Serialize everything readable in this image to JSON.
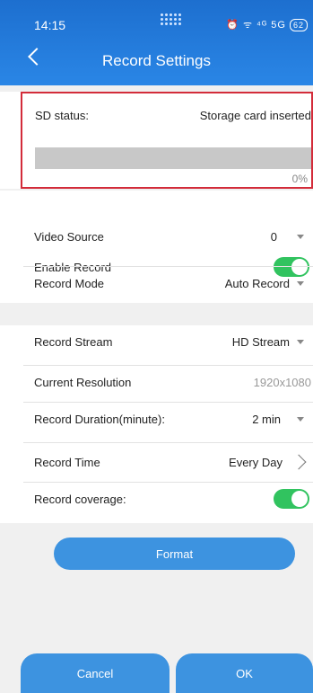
{
  "status_bar": {
    "time": "14:15",
    "signal_text": "⁴ᴳ 5G",
    "battery": "62"
  },
  "header": {
    "title": "Record Settings"
  },
  "sd": {
    "label": "SD status:",
    "value": "Storage card inserted",
    "progress_percent": 0,
    "progress_text": "0%"
  },
  "rows": {
    "video_source": {
      "label": "Video Source",
      "value": "0"
    },
    "enable_record": {
      "label": "Enable Record",
      "on": true
    },
    "record_mode": {
      "label": "Record Mode",
      "value": "Auto Record"
    },
    "record_stream": {
      "label": "Record Stream",
      "value": "HD Stream"
    },
    "current_resolution": {
      "label": "Current Resolution",
      "value": "1920x1080"
    },
    "record_duration": {
      "label": "Record Duration(minute):",
      "value": "2 min"
    },
    "record_time": {
      "label": "Record Time",
      "value": "Every Day"
    },
    "record_coverage": {
      "label": "Record coverage:",
      "on": true
    }
  },
  "buttons": {
    "format": "Format",
    "cancel": "Cancel",
    "ok": "OK"
  },
  "colors": {
    "header": "#2a86e6",
    "toggle_on": "#31c35f",
    "button": "#3d93e0",
    "highlight_border": "#d32c3a"
  }
}
